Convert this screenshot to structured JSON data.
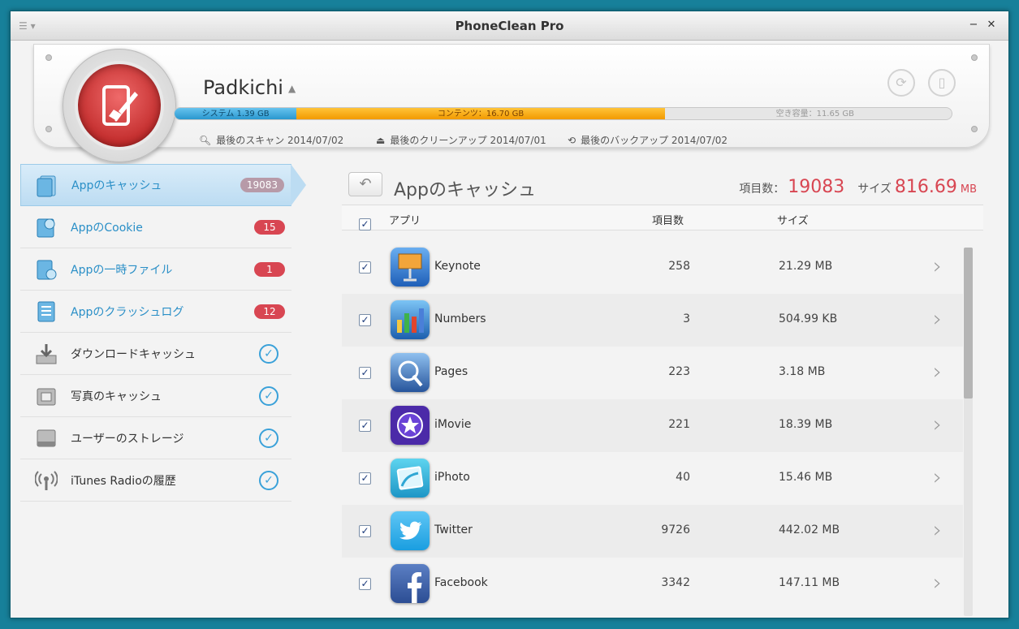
{
  "window": {
    "title": "PhoneClean Pro"
  },
  "device": {
    "name": "Padkichi",
    "storage": {
      "system_label": "システム 1.39 GB",
      "content_label": "コンテンツ：16.70 GB",
      "free_label": "空き容量：11.65 GB",
      "system_fraction": 0.157,
      "content_fraction": 0.474
    },
    "last_scan": "最後のスキャン 2014/07/02",
    "last_cleanup": "最後のクリーンアップ 2014/07/01",
    "last_backup": "最後のバックアップ 2014/07/02"
  },
  "sidebar": {
    "items": [
      {
        "label": "Appのキャッシュ",
        "badge": "19083",
        "active": true
      },
      {
        "label": "AppのCookie",
        "badge": "15"
      },
      {
        "label": "Appの一時ファイル",
        "badge": "1"
      },
      {
        "label": "Appのクラッシュログ",
        "badge": "12"
      },
      {
        "label": "ダウンロードキャッシュ",
        "checked": "✓"
      },
      {
        "label": "写真のキャッシュ",
        "checked": "✓"
      },
      {
        "label": "ユーザーのストレージ",
        "checked": "✓"
      },
      {
        "label": "iTunes Radioの履歴",
        "checked": "✓"
      }
    ]
  },
  "main": {
    "title": "Appのキャッシュ",
    "items_label": "項目数：",
    "items_count": "19083",
    "size_label": "サイズ",
    "size_value": "816.69",
    "size_unit": "MB",
    "columns": {
      "app": "アプリ",
      "count": "項目数",
      "size": "サイズ"
    },
    "rows": [
      {
        "name": "Keynote",
        "count": "258",
        "size": "21.29 MB",
        "icon": "keynote-icon"
      },
      {
        "name": "Numbers",
        "count": "3",
        "size": "504.99 KB",
        "icon": "numbers-icon"
      },
      {
        "name": "Pages",
        "count": "223",
        "size": "3.18 MB",
        "icon": "pages-icon"
      },
      {
        "name": "iMovie",
        "count": "221",
        "size": "18.39 MB",
        "icon": "imovie-icon"
      },
      {
        "name": "iPhoto",
        "count": "40",
        "size": "15.46 MB",
        "icon": "iphoto-icon"
      },
      {
        "name": "Twitter",
        "count": "9726",
        "size": "442.02 MB",
        "icon": "twitter-icon"
      },
      {
        "name": "Facebook",
        "count": "3342",
        "size": "147.11 MB",
        "icon": "facebook-icon"
      }
    ]
  },
  "colors": {
    "accent_blue": "#2a8fc7",
    "badge_red": "#d84652",
    "system_bar": "#2a97cf",
    "content_bar": "#f29a00"
  }
}
